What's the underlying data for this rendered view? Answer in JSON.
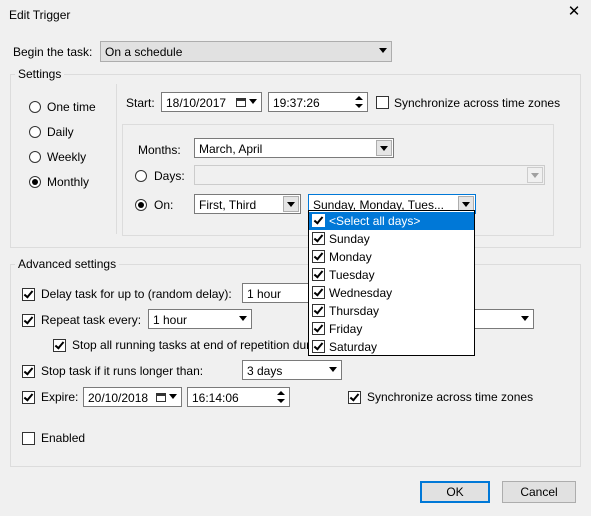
{
  "window": {
    "title": "Edit Trigger",
    "close_glyph": "✕"
  },
  "begin": {
    "label": "Begin the task:",
    "value": "On a schedule"
  },
  "settings": {
    "legend": "Settings",
    "freq": [
      {
        "label": "One time",
        "checked": false
      },
      {
        "label": "Daily",
        "checked": false
      },
      {
        "label": "Weekly",
        "checked": false
      },
      {
        "label": "Monthly",
        "checked": true
      }
    ],
    "start_label": "Start:",
    "start_date": "18/10/2017",
    "start_time": "19:37:26",
    "sync_label": "Synchronize across time zones",
    "months_label": "Months:",
    "months_value": "March, April",
    "days_label": "Days:",
    "days_value": "",
    "on_label": "On:",
    "on_week_value": "First, Third",
    "on_days_value": "Sunday, Monday, Tues..."
  },
  "day_list": [
    {
      "label": "<Select all days>",
      "checked": true,
      "selected": true
    },
    {
      "label": "Sunday",
      "checked": true
    },
    {
      "label": "Monday",
      "checked": true
    },
    {
      "label": "Tuesday",
      "checked": true
    },
    {
      "label": "Wednesday",
      "checked": true
    },
    {
      "label": "Thursday",
      "checked": true
    },
    {
      "label": "Friday",
      "checked": true
    },
    {
      "label": "Saturday",
      "checked": true
    }
  ],
  "advanced": {
    "legend": "Advanced settings",
    "delay_label": "Delay task for up to (random delay):",
    "delay_value": "1 hour",
    "repeat_label": "Repeat task every:",
    "repeat_value": "1 hour",
    "stop_all_label": "Stop all running tasks at end of repetition dur",
    "stop_if_label": "Stop task if it runs longer than:",
    "stop_if_value": "3 days",
    "expire_label": "Expire:",
    "expire_date": "20/10/2018",
    "expire_time": "16:14:06",
    "expire_sync_label": "Synchronize across time zones",
    "enabled_label": "Enabled"
  },
  "buttons": {
    "ok": "OK",
    "cancel": "Cancel"
  }
}
